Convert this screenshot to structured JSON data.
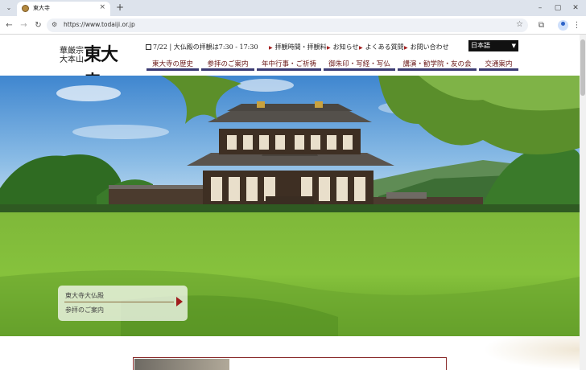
{
  "browser": {
    "tab_title": "東大寺",
    "tab_close": "×",
    "new_tab": "+",
    "url": "https://www.todaiji.or.jp",
    "window_buttons": [
      "–",
      "▢",
      "✕"
    ],
    "tab_list_icon": "chevron-down-icon"
  },
  "header": {
    "sect_line1": "華厳宗",
    "sect_line2": "大本山",
    "logo_text": "東大寺",
    "notice": "7/22 | 大仏殿の拝観は7:30 - 17:30",
    "quick_links": [
      "拝観時間・拝観料",
      "お知らせ",
      "よくある質問",
      "お問い合わせ"
    ],
    "language": "日本語"
  },
  "nav": {
    "items": [
      "東大寺の歴史",
      "参拝のご案内",
      "年中行事・ご祈祷",
      "御朱印・写経・写仏",
      "講演・勧学院・友の会",
      "交通案内"
    ]
  },
  "hero": {
    "caption_title": "東大寺大仏殿",
    "caption_sub": "参拝のご案内"
  },
  "colors": {
    "nav_underline": "#3b3b73",
    "nav_text": "#6b1a1a",
    "accent_red": "#a01c1c"
  }
}
